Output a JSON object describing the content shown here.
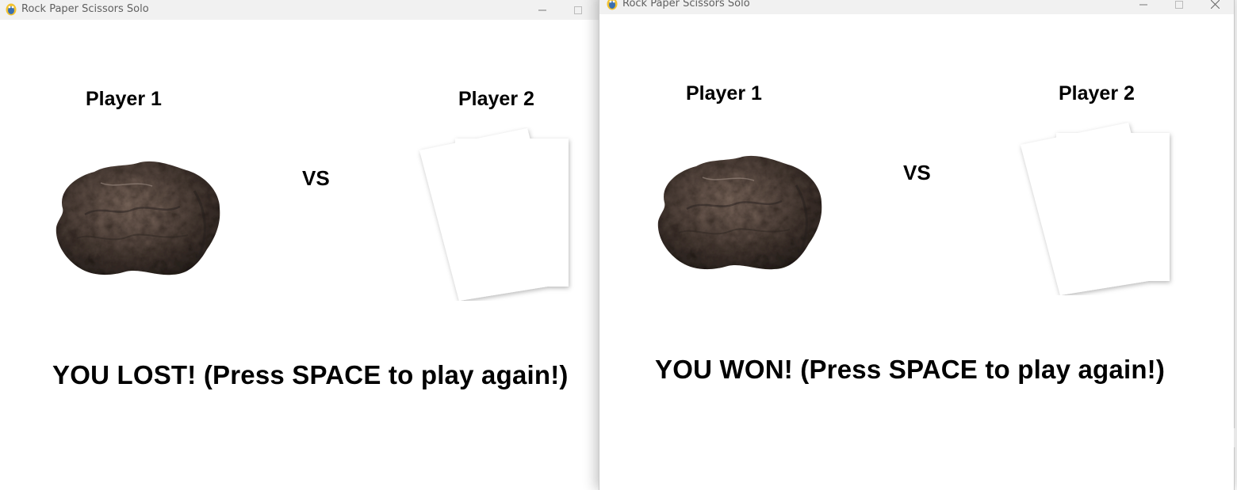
{
  "windows": [
    {
      "title": "Rock Paper Scissors Solo",
      "player1_label": "Player 1",
      "player2_label": "Player 2",
      "vs_label": "VS",
      "player1_choice": "rock",
      "player2_choice": "paper",
      "result_text": "YOU LOST! (Press SPACE to play again!)"
    },
    {
      "title": "Rock Paper Scissors Solo",
      "player1_label": "Player 1",
      "player2_label": "Player 2",
      "vs_label": "VS",
      "player1_choice": "rock",
      "player2_choice": "paper",
      "result_text": "YOU WON! (Press SPACE to play again!)"
    }
  ],
  "icons": {
    "app": "pygame-snake-icon",
    "minimize": "minimize-icon",
    "maximize": "maximize-icon",
    "close": "close-icon"
  }
}
